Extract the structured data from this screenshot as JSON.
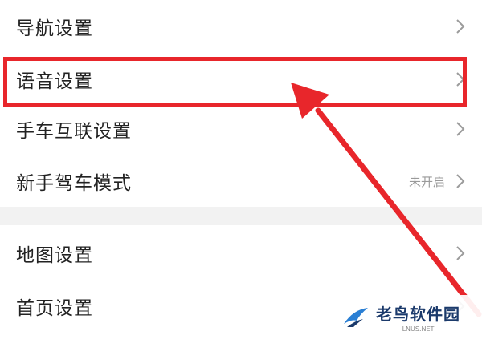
{
  "settings_groups": [
    {
      "items": [
        {
          "label": "导航设置",
          "status": ""
        },
        {
          "label": "语音设置",
          "status": ""
        },
        {
          "label": "手车互联设置",
          "status": ""
        },
        {
          "label": "新手驾车模式",
          "status": "未开启"
        }
      ]
    },
    {
      "items": [
        {
          "label": "地图设置",
          "status": ""
        },
        {
          "label": "首页设置",
          "status": ""
        }
      ]
    }
  ],
  "highlight": {
    "target": "语音设置",
    "color": "#e8262b"
  },
  "watermark": {
    "name": "老鸟软件园",
    "url": "LNUS.NET"
  },
  "colors": {
    "chevron": "#9b9b9b",
    "text": "#222222",
    "status": "#9a9a9a"
  }
}
